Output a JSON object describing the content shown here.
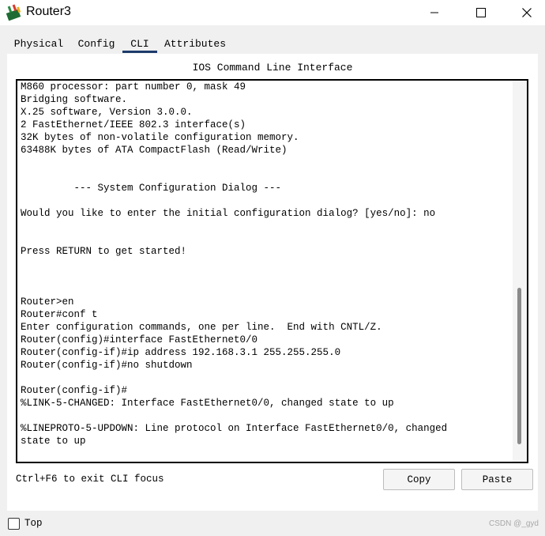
{
  "window": {
    "title": "Router3",
    "icon": "router-app-icon"
  },
  "tabs": [
    {
      "label": "Physical"
    },
    {
      "label": "Config"
    },
    {
      "label": "CLI"
    },
    {
      "label": "Attributes"
    }
  ],
  "active_tab": "CLI",
  "cli": {
    "heading": "IOS Command Line Interface",
    "lines": [
      "M860 processor: part number 0, mask 49",
      "Bridging software.",
      "X.25 software, Version 3.0.0.",
      "2 FastEthernet/IEEE 802.3 interface(s)",
      "32K bytes of non-volatile configuration memory.",
      "63488K bytes of ATA CompactFlash (Read/Write)",
      "",
      "",
      "         --- System Configuration Dialog ---",
      "",
      "Would you like to enter the initial configuration dialog? [yes/no]: no",
      "",
      "",
      "Press RETURN to get started!",
      "",
      "",
      "",
      "Router>en",
      "Router#conf t",
      "Enter configuration commands, one per line.  End with CNTL/Z.",
      "Router(config)#interface FastEthernet0/0",
      "Router(config-if)#ip address 192.168.3.1 255.255.255.0",
      "Router(config-if)#no shutdown",
      "",
      "Router(config-if)#",
      "%LINK-5-CHANGED: Interface FastEthernet0/0, changed state to up",
      "",
      "%LINEPROTO-5-UPDOWN: Line protocol on Interface FastEthernet0/0, changed",
      "state to up"
    ],
    "exit_hint": "Ctrl+F6 to exit CLI focus",
    "copy_label": "Copy",
    "paste_label": "Paste"
  },
  "footer": {
    "top_label": "Top",
    "top_checked": false,
    "watermark": "CSDN @_gyd"
  }
}
